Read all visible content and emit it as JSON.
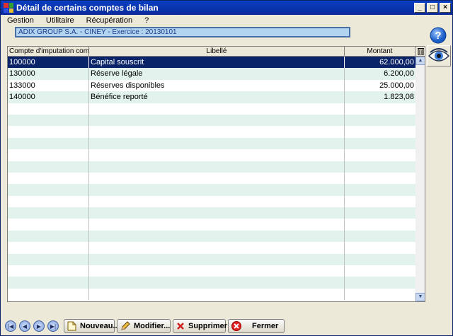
{
  "window": {
    "title": "Détail de certains comptes de bilan"
  },
  "menu": [
    {
      "label": "Gestion"
    },
    {
      "label": "Utilitaire"
    },
    {
      "label": "Récupération"
    },
    {
      "label": "?"
    }
  ],
  "context": {
    "text": "ADIX GROUP S.A.   - CINEY - Exercice : 20130101"
  },
  "grid": {
    "columns": [
      "Compte d'imputation comp",
      "Libellé",
      "Montant"
    ],
    "rows": [
      {
        "compte": "100000",
        "libelle": "Capital souscrit",
        "montant": "62.000,00",
        "selected": true
      },
      {
        "compte": "130000",
        "libelle": "Réserve légale",
        "montant": "6.200,00"
      },
      {
        "compte": "133000",
        "libelle": "Réserves disponibles",
        "montant": "25.000,00"
      },
      {
        "compte": "140000",
        "libelle": "Bénéfice reporté",
        "montant": "1.823,08"
      }
    ]
  },
  "buttons": {
    "new": "Nouveau...",
    "modify": "Modifier...",
    "delete": "Supprimer",
    "close": "Fermer"
  },
  "icons": {
    "help": "help-icon",
    "eye": "eye-icon",
    "trash": "trash-icon"
  },
  "colors": {
    "selection": "#0a246a",
    "row_alt": "#e2f2ec",
    "titlebar": "#0a3fc4"
  }
}
